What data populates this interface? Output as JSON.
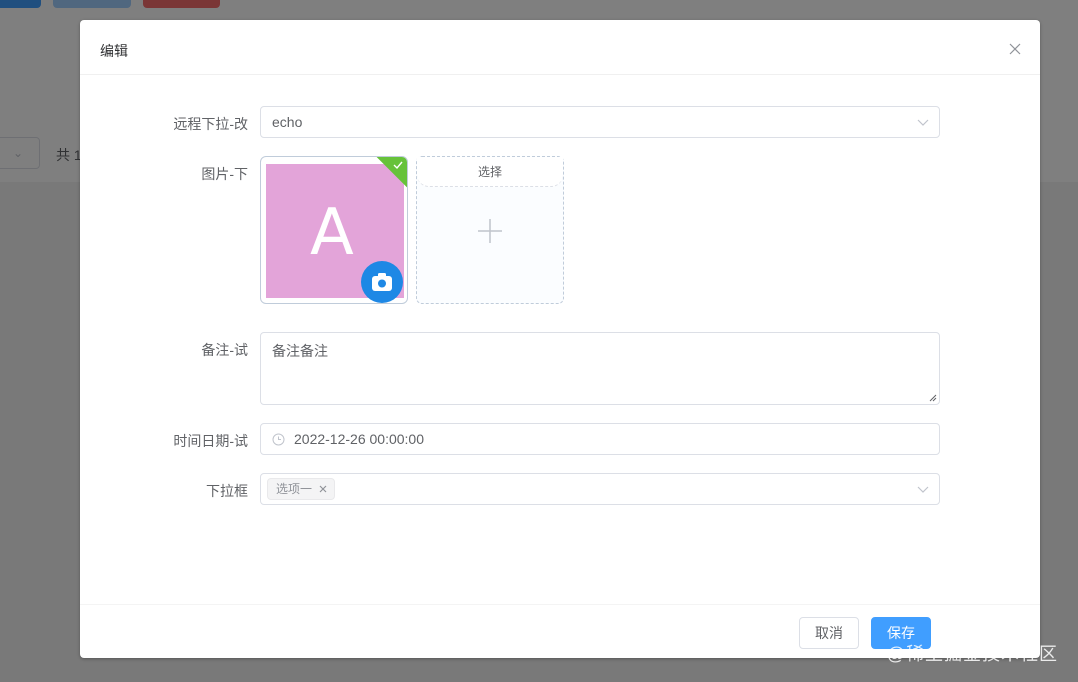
{
  "background": {
    "total_text": "共 1"
  },
  "dialog": {
    "title": "编辑",
    "fields": {
      "remote_select": {
        "label": "远程下拉-改",
        "value": "echo"
      },
      "image": {
        "label": "图片-下",
        "avatar_letter": "A",
        "choose_label": "选择"
      },
      "remark": {
        "label": "备注-试",
        "value": "备注备注"
      },
      "datetime": {
        "label": "时间日期-试",
        "value": "2022-12-26 00:00:00"
      },
      "dropdown": {
        "label": "下拉框",
        "tags": [
          "选项一"
        ]
      }
    },
    "footer": {
      "cancel_label": "取消",
      "save_label": "保存"
    }
  },
  "watermark": "@稀土掘金技术社区",
  "colors": {
    "primary": "#409eff",
    "success": "#67c23a",
    "avatar_bg": "#e3a4d9",
    "camera_badge": "#1e88e5"
  },
  "icons": [
    "close-icon",
    "chevron-down-icon",
    "check-icon",
    "camera-icon",
    "plus-icon",
    "clock-icon",
    "tag-close-icon"
  ]
}
